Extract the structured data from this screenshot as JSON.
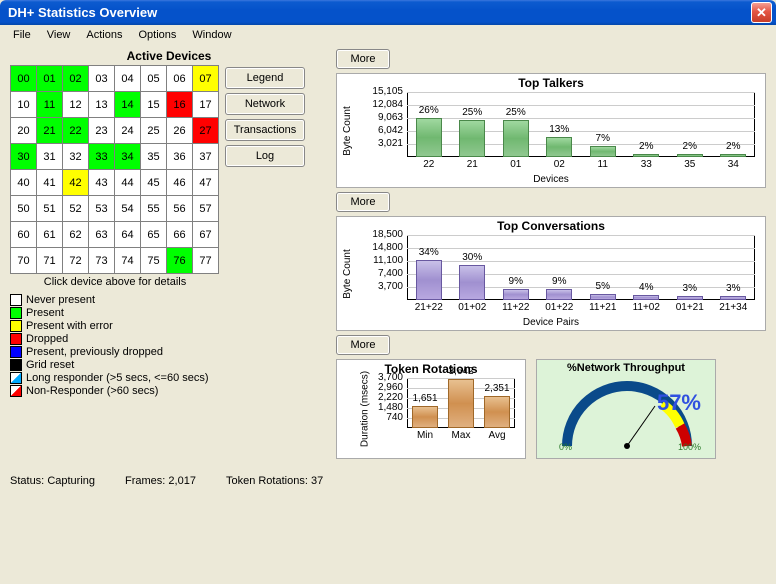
{
  "window": {
    "title": "DH+ Statistics Overview"
  },
  "menu": {
    "items": [
      "File",
      "View",
      "Actions",
      "Options",
      "Window"
    ]
  },
  "devices": {
    "title": "Active Devices",
    "caption": "Click device above for details",
    "grid": [
      [
        {
          "n": "00",
          "c": "green"
        },
        {
          "n": "01",
          "c": "green"
        },
        {
          "n": "02",
          "c": "green"
        },
        {
          "n": "03"
        },
        {
          "n": "04"
        },
        {
          "n": "05"
        },
        {
          "n": "06"
        },
        {
          "n": "07",
          "c": "yellow"
        }
      ],
      [
        {
          "n": "10"
        },
        {
          "n": "11",
          "c": "green"
        },
        {
          "n": "12"
        },
        {
          "n": "13"
        },
        {
          "n": "14",
          "c": "green"
        },
        {
          "n": "15"
        },
        {
          "n": "16",
          "c": "red"
        },
        {
          "n": "17"
        }
      ],
      [
        {
          "n": "20"
        },
        {
          "n": "21",
          "c": "green"
        },
        {
          "n": "22",
          "c": "green"
        },
        {
          "n": "23"
        },
        {
          "n": "24"
        },
        {
          "n": "25"
        },
        {
          "n": "26"
        },
        {
          "n": "27",
          "c": "red"
        }
      ],
      [
        {
          "n": "30",
          "c": "green"
        },
        {
          "n": "31"
        },
        {
          "n": "32"
        },
        {
          "n": "33",
          "c": "green"
        },
        {
          "n": "34",
          "c": "green"
        },
        {
          "n": "35"
        },
        {
          "n": "36"
        },
        {
          "n": "37"
        }
      ],
      [
        {
          "n": "40"
        },
        {
          "n": "41"
        },
        {
          "n": "42",
          "c": "yellow"
        },
        {
          "n": "43"
        },
        {
          "n": "44"
        },
        {
          "n": "45"
        },
        {
          "n": "46"
        },
        {
          "n": "47"
        }
      ],
      [
        {
          "n": "50"
        },
        {
          "n": "51"
        },
        {
          "n": "52"
        },
        {
          "n": "53"
        },
        {
          "n": "54"
        },
        {
          "n": "55"
        },
        {
          "n": "56"
        },
        {
          "n": "57"
        }
      ],
      [
        {
          "n": "60"
        },
        {
          "n": "61"
        },
        {
          "n": "62"
        },
        {
          "n": "63"
        },
        {
          "n": "64"
        },
        {
          "n": "65"
        },
        {
          "n": "66"
        },
        {
          "n": "67"
        }
      ],
      [
        {
          "n": "70"
        },
        {
          "n": "71"
        },
        {
          "n": "72"
        },
        {
          "n": "73"
        },
        {
          "n": "74"
        },
        {
          "n": "75"
        },
        {
          "n": "76",
          "c": "green"
        },
        {
          "n": "77"
        }
      ]
    ]
  },
  "side_buttons": {
    "legend": "Legend",
    "network": "Network",
    "transactions": "Transactions",
    "log": "Log"
  },
  "legend": {
    "items": [
      {
        "color": "#ffffff",
        "label": "Never present"
      },
      {
        "color": "#00ff00",
        "label": "Present"
      },
      {
        "color": "#ffff00",
        "label": "Present with error"
      },
      {
        "color": "#ff0000",
        "label": "Dropped"
      },
      {
        "color": "#0000ff",
        "label": "Present, previously dropped"
      },
      {
        "color": "#000000",
        "label": "Grid reset"
      },
      {
        "color": "#ffffff",
        "diag": "#00aaff",
        "label": "Long responder (>5 secs, <=60 secs)"
      },
      {
        "color": "#ffffff",
        "diag": "#ff0000",
        "label": "Non-Responder (>60 secs)"
      }
    ]
  },
  "more_label": "More",
  "chart_data": [
    {
      "id": "top_talkers",
      "type": "bar",
      "title": "Top Talkers",
      "ylabel": "Byte Count",
      "xlabel": "Devices",
      "y_ticks": [
        "15,105",
        "12,084",
        "9,063",
        "6,042",
        "3,021"
      ],
      "categories": [
        "22",
        "21",
        "01",
        "02",
        "11",
        "33",
        "35",
        "34"
      ],
      "values": [
        9000,
        8600,
        8500,
        4700,
        2500,
        800,
        800,
        800
      ],
      "value_labels": [
        "26%",
        "25%",
        "25%",
        "13%",
        "7%",
        "2%",
        "2%",
        "2%"
      ],
      "ylim": [
        0,
        15105
      ],
      "color": "green"
    },
    {
      "id": "top_conv",
      "type": "bar",
      "title": "Top Conversations",
      "ylabel": "Byte Count",
      "xlabel": "Device Pairs",
      "y_ticks": [
        "18,500",
        "14,800",
        "11,100",
        "7,400",
        "3,700"
      ],
      "categories": [
        "21+22",
        "01+02",
        "11+22",
        "01+22",
        "11+21",
        "11+02",
        "01+21",
        "21+34"
      ],
      "values": [
        11400,
        10100,
        3000,
        3000,
        1800,
        1500,
        1100,
        1100
      ],
      "value_labels": [
        "34%",
        "30%",
        "9%",
        "9%",
        "5%",
        "4%",
        "3%",
        "3%"
      ],
      "ylim": [
        0,
        18500
      ],
      "color": "purple"
    },
    {
      "id": "token_rot",
      "type": "bar",
      "title": "Token Rotations",
      "ylabel": "Duration (msecs)",
      "xlabel": "",
      "y_ticks": [
        "3,700",
        "2,960",
        "2,220",
        "1,480",
        "740"
      ],
      "categories": [
        "Min",
        "Max",
        "Avg"
      ],
      "values": [
        1651,
        3642,
        2351
      ],
      "value_labels": [
        "1,651",
        "3,642",
        "2,351"
      ],
      "ylim": [
        0,
        3700
      ],
      "color": "orange"
    }
  ],
  "gauge": {
    "title": "%Network Throughput",
    "percent": "57%",
    "min": "0%",
    "max": "100%",
    "value": 57
  },
  "status": {
    "status_lbl": "Status:",
    "status_val": "Capturing",
    "frames_lbl": "Frames:",
    "frames_val": "2,017",
    "rot_lbl": "Token Rotations:",
    "rot_val": "37"
  }
}
